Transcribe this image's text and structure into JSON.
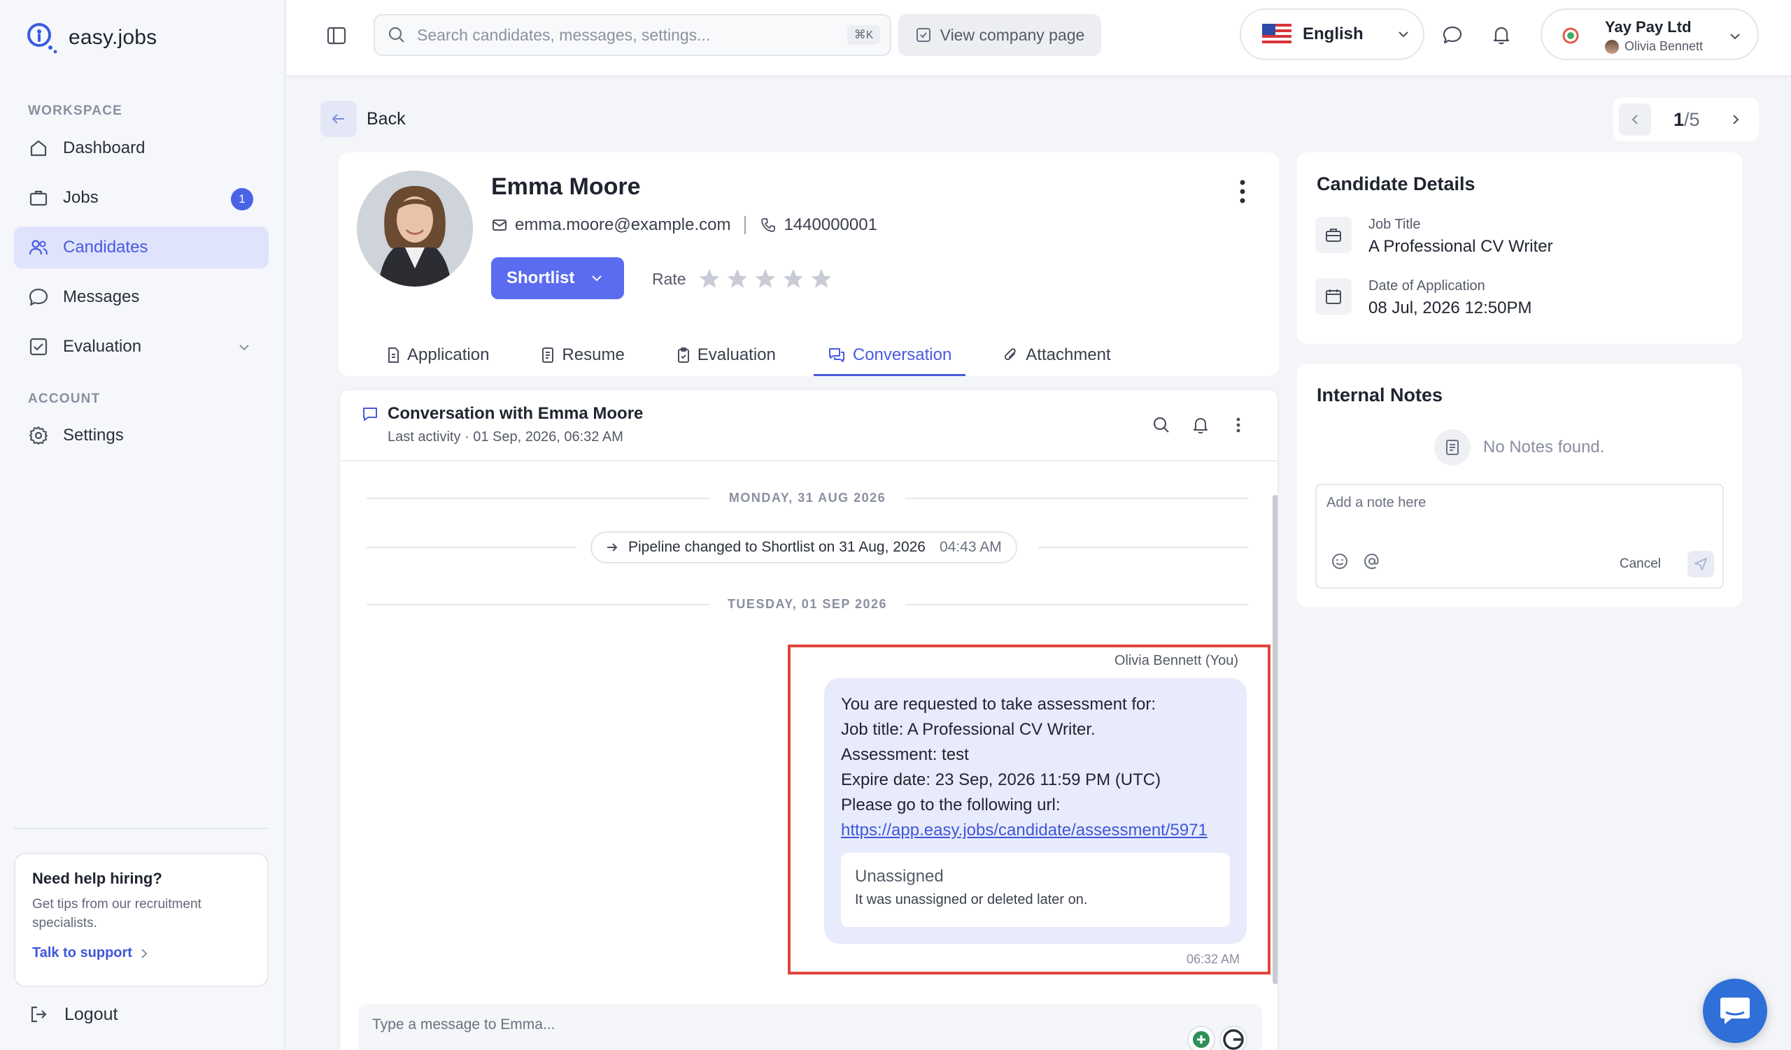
{
  "app": {
    "brand": "easy.jobs"
  },
  "sidebar": {
    "workspace_label": "WORKSPACE",
    "account_label": "ACCOUNT",
    "items": [
      {
        "label": "Dashboard",
        "icon": "home-icon"
      },
      {
        "label": "Jobs",
        "icon": "briefcase-icon",
        "badge": "1"
      },
      {
        "label": "Candidates",
        "icon": "users-icon",
        "active": true
      },
      {
        "label": "Messages",
        "icon": "chat-bubble-icon"
      },
      {
        "label": "Evaluation",
        "icon": "checkbox-icon",
        "has_children": true
      },
      {
        "label": "Settings",
        "icon": "gear-icon"
      }
    ],
    "help": {
      "title": "Need help hiring?",
      "text": "Get tips from our recruitment specialists.",
      "link": "Talk to support"
    },
    "logout": "Logout"
  },
  "topbar": {
    "search_placeholder": "Search candidates, messages, settings...",
    "search_shortcut": "⌘K",
    "view_company": "View company page",
    "language": "English",
    "company_name": "Yay Pay Ltd",
    "user_name": "Olivia Bennett"
  },
  "nav": {
    "back": "Back",
    "pager_current": "1",
    "pager_total": "/5"
  },
  "candidate": {
    "name": "Emma Moore",
    "email": "emma.moore@example.com",
    "phone": "1440000001",
    "status": "Shortlist",
    "rate_label": "Rate",
    "rating": 0,
    "rating_max": 5
  },
  "tabs": [
    {
      "label": "Application",
      "icon": "file-icon"
    },
    {
      "label": "Resume",
      "icon": "document-icon"
    },
    {
      "label": "Evaluation",
      "icon": "clipboard-icon"
    },
    {
      "label": "Conversation",
      "icon": "chat-icon",
      "active": true
    },
    {
      "label": "Attachment",
      "icon": "paperclip-icon"
    }
  ],
  "conversation": {
    "title": "Conversation with Emma Moore",
    "last_activity": "Last activity · 01 Sep, 2026, 06:32 AM",
    "day1": "MONDAY, 31 AUG 2026",
    "event_text": "Pipeline changed to Shortlist on 31 Aug, 2026",
    "event_time": "04:43 AM",
    "day2": "TUESDAY, 01 SEP 2026",
    "message": {
      "sender": "Olivia Bennett (You)",
      "lines": [
        "You are requested to take assessment for:",
        "Job title: A Professional CV Writer.",
        "Assessment: test",
        "Expire date: 23 Sep, 2026 11:59 PM (UTC)",
        "Please go to the following url:"
      ],
      "url": "https://app.easy.jobs/candidate/assessment/5971",
      "card_title": "Unassigned",
      "card_text": "It was unassigned or deleted later on.",
      "time": "06:32 AM"
    },
    "composer_placeholder": "Type a message to Emma..."
  },
  "details": {
    "title": "Candidate Details",
    "job_title_label": "Job Title",
    "job_title": "A Professional CV Writer",
    "date_label": "Date of Application",
    "date": "08 Jul, 2026 12:50PM"
  },
  "notes": {
    "title": "Internal Notes",
    "empty": "No Notes found.",
    "placeholder": "Add a note here",
    "cancel": "Cancel"
  },
  "colors": {
    "accent": "#4a5be0",
    "button": "#5b6cf0",
    "highlight": "#e1463c",
    "bubble": "#e8ebfb"
  }
}
